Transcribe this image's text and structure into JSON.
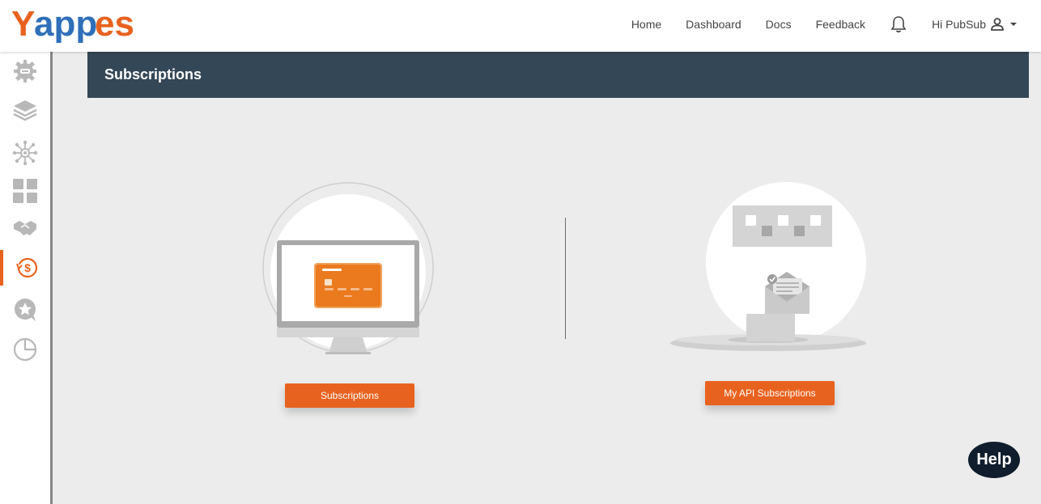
{
  "brand": {
    "logo_text_parts": [
      "Y",
      "app",
      "es"
    ],
    "colors": {
      "orange": "#e8621f",
      "blue": "#2f6fb9",
      "header_band": "#344756",
      "help": "#0f1d2c"
    }
  },
  "nav": {
    "items": [
      "Home",
      "Dashboard",
      "Docs",
      "Feedback"
    ],
    "greeting": "Hi PubSub"
  },
  "sidebar": {
    "icons": [
      "gear-icon",
      "layers-icon",
      "network-icon",
      "grid-icon",
      "handshake-icon",
      "dollar-cycle-icon",
      "star-chat-icon",
      "pie-chart-icon"
    ],
    "active_index": 5
  },
  "page": {
    "title": "Subscriptions"
  },
  "cards": {
    "subscriptions_button": "Subscriptions",
    "my_api_subscriptions_button": "My API Subscriptions"
  },
  "help": {
    "label": "Help"
  }
}
